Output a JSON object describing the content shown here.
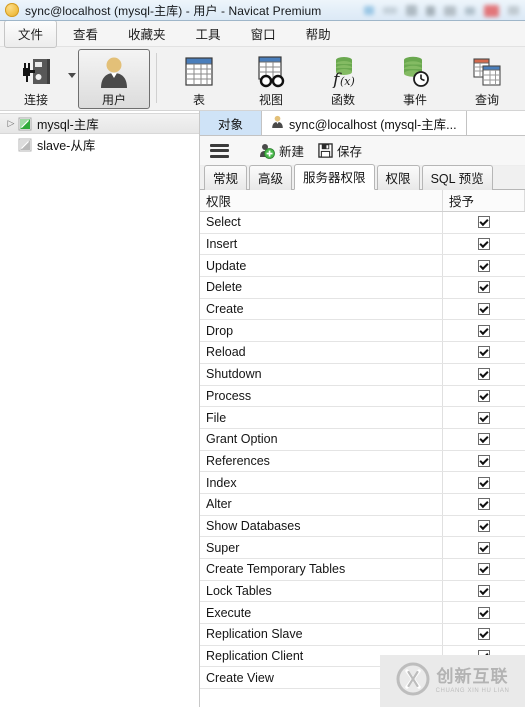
{
  "window": {
    "title": "sync@localhost (mysql-主库) - 用户 - Navicat Premium",
    "app_icon": "navicat-circle-icon"
  },
  "menubar": {
    "items": [
      {
        "label": "文件",
        "active": true
      },
      {
        "label": "查看",
        "active": false
      },
      {
        "label": "收藏夹",
        "active": false
      },
      {
        "label": "工具",
        "active": false
      },
      {
        "label": "窗口",
        "active": false
      },
      {
        "label": "帮助",
        "active": false
      }
    ]
  },
  "toolbar": {
    "buttons": [
      {
        "label": "连接",
        "icon": "connection-icon",
        "pressed": false,
        "has_dropdown": true
      },
      {
        "label": "用户",
        "icon": "user-icon",
        "pressed": true,
        "has_dropdown": false
      },
      {
        "label": "表",
        "icon": "table-icon",
        "pressed": false,
        "has_dropdown": false
      },
      {
        "label": "视图",
        "icon": "view-glasses-icon",
        "pressed": false,
        "has_dropdown": false
      },
      {
        "label": "函数",
        "icon": "function-icon",
        "pressed": false,
        "has_dropdown": false
      },
      {
        "label": "事件",
        "icon": "event-clock-icon",
        "pressed": false,
        "has_dropdown": false
      },
      {
        "label": "查询",
        "icon": "query-icon",
        "pressed": false,
        "has_dropdown": false
      }
    ]
  },
  "sidebar": {
    "items": [
      {
        "label": "mysql-主库",
        "icon": "connection-green-icon",
        "expandable": true,
        "selected": true
      },
      {
        "label": "slave-从库",
        "icon": "connection-gray-icon",
        "expandable": false,
        "selected": false
      }
    ]
  },
  "doc_tabs": {
    "tabs": [
      {
        "label": "对象",
        "icon": null,
        "active": false,
        "style": "objects"
      },
      {
        "label": "sync@localhost (mysql-主库...",
        "icon": "user-icon",
        "active": true,
        "style": "current"
      }
    ]
  },
  "subtoolbar": {
    "menu_icon": "hamburger-icon",
    "buttons": [
      {
        "label": "新建",
        "icon": "new-user-plus-icon"
      },
      {
        "label": "保存",
        "icon": "save-floppy-icon"
      }
    ]
  },
  "inner_tabs": {
    "tabs": [
      {
        "label": "常规",
        "active": false
      },
      {
        "label": "高级",
        "active": false
      },
      {
        "label": "服务器权限",
        "active": true
      },
      {
        "label": "权限",
        "active": false
      },
      {
        "label": "SQL 预览",
        "active": false
      }
    ]
  },
  "grid": {
    "columns": [
      "权限",
      "授予"
    ],
    "rows": [
      {
        "privilege": "Select",
        "granted": true
      },
      {
        "privilege": "Insert",
        "granted": true
      },
      {
        "privilege": "Update",
        "granted": true
      },
      {
        "privilege": "Delete",
        "granted": true
      },
      {
        "privilege": "Create",
        "granted": true
      },
      {
        "privilege": "Drop",
        "granted": true
      },
      {
        "privilege": "Reload",
        "granted": true
      },
      {
        "privilege": "Shutdown",
        "granted": true
      },
      {
        "privilege": "Process",
        "granted": true
      },
      {
        "privilege": "File",
        "granted": true
      },
      {
        "privilege": "Grant Option",
        "granted": true
      },
      {
        "privilege": "References",
        "granted": true
      },
      {
        "privilege": "Index",
        "granted": true
      },
      {
        "privilege": "Alter",
        "granted": true
      },
      {
        "privilege": "Show Databases",
        "granted": true
      },
      {
        "privilege": "Super",
        "granted": true
      },
      {
        "privilege": "Create Temporary Tables",
        "granted": true
      },
      {
        "privilege": "Lock Tables",
        "granted": true
      },
      {
        "privilege": "Execute",
        "granted": true
      },
      {
        "privilege": "Replication Slave",
        "granted": true
      },
      {
        "privilege": "Replication Client",
        "granted": true
      },
      {
        "privilege": "Create View",
        "granted": true
      }
    ]
  },
  "watermark": {
    "logo": "cx-circle-logo",
    "chinese": "创新互联",
    "pinyin": "CHUANG XIN HU LIAN"
  }
}
